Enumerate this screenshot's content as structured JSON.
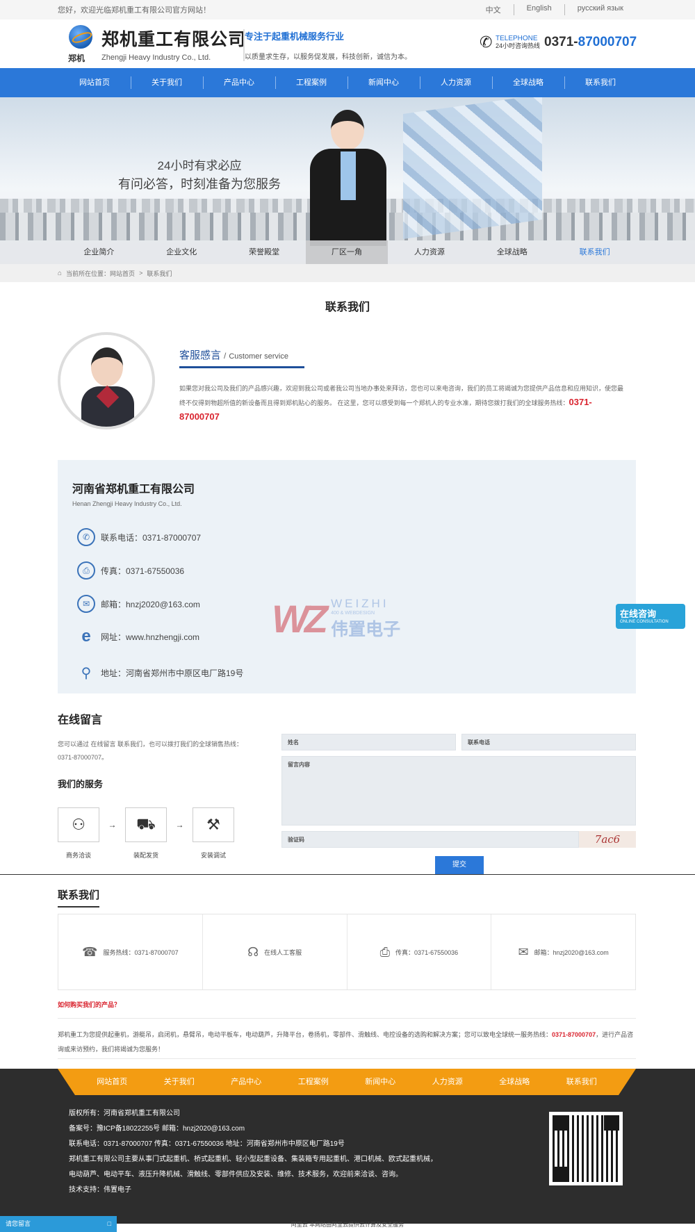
{
  "topbar": {
    "welcome": "您好，欢迎光临郑机重工有限公司官方网站！",
    "langs": [
      "中文",
      "English",
      "русский язык"
    ]
  },
  "header": {
    "logo_mark_text": "郑机",
    "company_cn": "郑机重工有限公司",
    "company_en": "Zhengji Heavy Industry Co., Ltd.",
    "slogan_title": "专注于起重机械服务行业",
    "slogan_sub": "以质量求生存，以服务促发展，科技创新，诚信为本。",
    "tel_label_en": "TELEPHONE",
    "tel_label_cn": "24小时咨询热线",
    "tel_prefix": "0371-",
    "tel_number": "87000707"
  },
  "nav": [
    "网站首页",
    "关于我们",
    "产品中心",
    "工程案例",
    "新闻中心",
    "人力资源",
    "全球战略",
    "联系我们"
  ],
  "banner": {
    "line1": "24小时有求必应",
    "line2": "有问必答，时刻准备为您服务"
  },
  "subnav": [
    "企业简介",
    "企业文化",
    "荣誉殿堂",
    "厂区一角",
    "人力资源",
    "全球战略",
    "联系我们"
  ],
  "breadcrumb": {
    "prefix": "当前所在位置：网站首页",
    "sep": ">",
    "current": "联系我们"
  },
  "page_title": "联系我们",
  "service": {
    "title": "客服感言",
    "sep": "/",
    "title_en": "Customer service",
    "desc": "如果您对我公司及我们的产品感兴趣，欢迎到我公司或者我公司当地办事处来拜访，您也可以来电咨询，我们的员工将竭诚为您提供产品信息和应用知识，使您最终不仅得到物超所值的新设备而且得到郑机贴心的服务。 在这里，您可以感受到每一个郑机人的专业水准，期待您拨打我们的全球服务热线：",
    "hotline": "0371-87000707"
  },
  "company": {
    "name": "河南省郑机重工有限公司",
    "name_en": "Henan Zhengji Heavy Industry Co., Ltd.",
    "rows": [
      {
        "icon": "phone-icon",
        "text": "联系电话：0371-87000707"
      },
      {
        "icon": "fax-icon",
        "text": "传真：0371-67550036"
      },
      {
        "icon": "mail-icon",
        "text": "邮箱：hnzj2020@163.com"
      },
      {
        "icon": "ie-icon",
        "text": "网址：www.hnzhengji.com"
      },
      {
        "icon": "location-icon",
        "text": "地址：河南省郑州市中原区电厂路19号"
      }
    ]
  },
  "watermark": {
    "wz": "WZ",
    "en": "WEIZHI",
    "sub": "400 & WEBDESIGN",
    "cn": "伟置电子"
  },
  "message": {
    "title": "在线留言",
    "intro": "您可以通过 在线留言 联系我们，也可以拨打我们的全球销售热线：0371-87000707。",
    "services_title": "我们的服务",
    "steps": [
      "商务洽谈",
      "装配发货",
      "安装调试"
    ],
    "arrow": "→",
    "name_placeholder": "姓名",
    "phone_placeholder": "联系电话",
    "content_placeholder": "留言内容",
    "code_placeholder": "验证码",
    "captcha": "7ac6",
    "submit": "提交"
  },
  "contact_section": {
    "title": "联系我们",
    "cards": [
      {
        "icon": "phone-icon",
        "text": "服务热线：0371-87000707"
      },
      {
        "icon": "headset-icon",
        "text": "在线人工客服"
      },
      {
        "icon": "printer-icon",
        "text": "传真：0371-67550036"
      },
      {
        "icon": "mail-icon",
        "text": "邮箱：hnzj2020@163.com"
      }
    ],
    "how_buy": "如何购买我们的产品？",
    "products_text": "郑机重工为您提供起重机，游艇吊，启闭机，悬臂吊，电动平板车，电动葫芦，升降平台，卷扬机，零部件、滑触线、电控设备的选购和解决方案；您可以致电全球统一服务热线：",
    "products_hotline": "0371-87000707",
    "products_tail": "，进行产品咨询或来访预约，我们将竭诚为您服务！"
  },
  "footer": {
    "nav": [
      "网站首页",
      "关于我们",
      "产品中心",
      "工程案例",
      "新闻中心",
      "人力资源",
      "全球战略",
      "联系我们"
    ],
    "copyright": "版权所有：河南省郑机重工有限公司",
    "icp": "备案号：豫ICP备18022255号   邮箱：hnzj2020@163.com",
    "contact": "联系电话：0371-87000707  传真：0371-67550036  地址：河南省郑州市中原区电厂路19号",
    "desc1": "郑机重工有限公司主要从事门式起重机、桥式起重机、轻小型起重设备、集装箱专用起重机、港口机械、欧式起重机械，",
    "desc2": "电动葫芦、电动平车、液压升降机械、滑触线、零部件供应及安装、维修、技术服务，欢迎前来洽谈、咨询。",
    "tech": "技术支持：伟置电子"
  },
  "floating": {
    "online_cn": "在线咨询",
    "online_en": "ONLINE CONSULTATION",
    "chat": "请您留言",
    "chat_btn": "□"
  },
  "bottom_line": "阿里云  本网站由阿里云提供云计算及安全服务",
  "colors": {
    "primary": "#2b78d9",
    "accent": "#f39c12",
    "hot": "#d9232e",
    "footer": "#2d2d2d"
  }
}
